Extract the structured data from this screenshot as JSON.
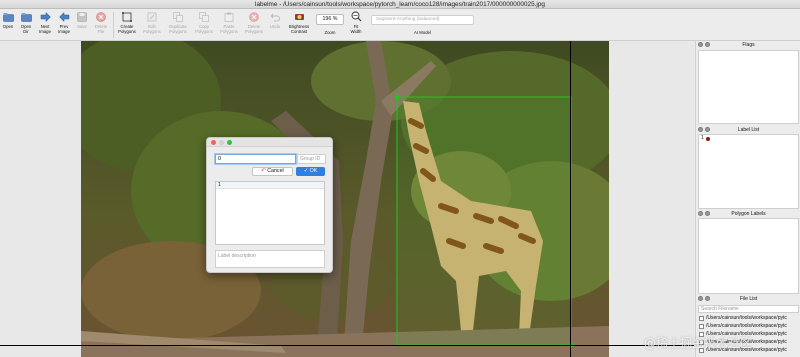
{
  "window": {
    "title": "labelme - /Users/cainsun/tools/workspace/pytorch_learn/coco128/images/train2017/000000000025.jpg"
  },
  "toolbar": {
    "buttons": [
      {
        "id": "open",
        "label": "Open",
        "icon": "folder-icon",
        "enabled": true
      },
      {
        "id": "open_dir",
        "label": "Open\nDir",
        "icon": "folder-icon",
        "enabled": true
      },
      {
        "id": "next_image",
        "label": "Next\nImage",
        "icon": "arrow-right-icon",
        "enabled": true
      },
      {
        "id": "prev_image",
        "label": "Prev\nImage",
        "icon": "arrow-left-icon",
        "enabled": true
      },
      {
        "id": "save",
        "label": "Save",
        "icon": "save-icon",
        "enabled": false
      },
      {
        "id": "delete_file",
        "label": "Delete\nFile",
        "icon": "delete-icon",
        "enabled": false
      },
      {
        "id": "create_polygons",
        "label": "Create\nPolygons",
        "icon": "polygon-icon",
        "enabled": true
      },
      {
        "id": "edit_polygons",
        "label": "Edit\nPolygons",
        "icon": "edit-icon",
        "enabled": false
      },
      {
        "id": "duplicate_polygons",
        "label": "Duplicate\nPolygons",
        "icon": "copy-icon",
        "enabled": false
      },
      {
        "id": "copy_polygons",
        "label": "Copy\nPolygons",
        "icon": "copy-icon",
        "enabled": false
      },
      {
        "id": "paste_polygons",
        "label": "Paste\nPolygons",
        "icon": "paste-icon",
        "enabled": false
      },
      {
        "id": "delete_polygons",
        "label": "Delete\nPolygons",
        "icon": "cancel-icon",
        "enabled": false
      },
      {
        "id": "undo",
        "label": "Undo",
        "icon": "undo-icon",
        "enabled": false
      },
      {
        "id": "brightness",
        "label": "Brightness\nContrast",
        "icon": "brightness-icon",
        "enabled": true
      },
      {
        "id": "fit_width",
        "label": "Fit\nWidth",
        "icon": "fit-width-icon",
        "enabled": true
      }
    ],
    "zoom": {
      "value": "196 %",
      "label": "Zoom"
    },
    "ai_model": {
      "selected": "Segment-Anything (balanced)",
      "label": "AI Model"
    }
  },
  "dialog": {
    "label_value": "0",
    "group_id_placeholder": "Group ID",
    "cancel_label": "Cancel",
    "ok_label": "OK",
    "label_list": [
      "1"
    ],
    "description_placeholder": "Label description"
  },
  "panels": {
    "flags_title": "Flags",
    "label_list_title": "Label List",
    "label_list_items": [
      {
        "text": "1",
        "color": "#8a1a12"
      }
    ],
    "polygon_labels_title": "Polygon Labels",
    "file_list_title": "File List",
    "search_placeholder": "Search Filename",
    "files": [
      "/Users/cainsun/tools/workspace/pytc",
      "/Users/cainsun/tools/workspace/pytc",
      "/Users/cainsun/tools/workspace/pytc",
      "/Users/cainsun/tools/workspace/pytc",
      "/Users/cainsun/tools/workspace/pytc"
    ]
  },
  "watermark": "@稀土掘金技术社区",
  "colors": {
    "accent": "#2f7fe0",
    "bbox_green": "#22c422"
  }
}
